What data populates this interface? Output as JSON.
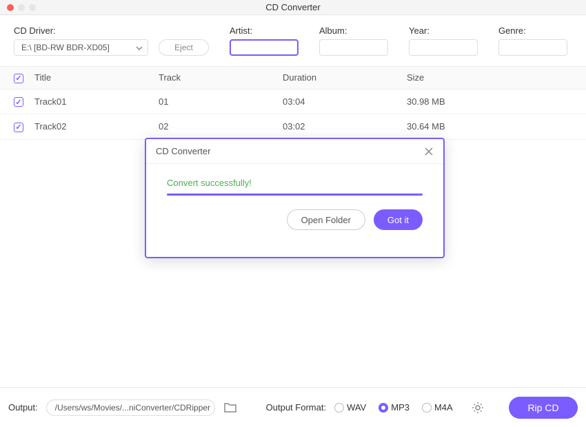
{
  "window": {
    "title": "CD Converter"
  },
  "form": {
    "cd_driver_label": "CD Driver:",
    "cd_driver_value": "E:\\ [BD-RW   BDR-XD05]",
    "eject_label": "Eject",
    "artist_label": "Artist:",
    "artist_value": "",
    "album_label": "Album:",
    "album_value": "",
    "year_label": "Year:",
    "year_value": "",
    "genre_label": "Genre:",
    "genre_value": ""
  },
  "table": {
    "headers": {
      "title": "Title",
      "track": "Track",
      "duration": "Duration",
      "size": "Size"
    },
    "rows": [
      {
        "title": "Track01",
        "track": "01",
        "duration": "03:04",
        "size": "30.98 MB"
      },
      {
        "title": "Track02",
        "track": "02",
        "duration": "03:02",
        "size": "30.64 MB"
      }
    ]
  },
  "modal": {
    "title": "CD Converter",
    "message": "Convert successfully!",
    "open_folder": "Open Folder",
    "got_it": "Got it"
  },
  "bottom": {
    "output_label": "Output:",
    "output_path": "/Users/ws/Movies/...niConverter/CDRipper",
    "format_label": "Output Format:",
    "formats": {
      "wav": "WAV",
      "mp3": "MP3",
      "m4a": "M4A"
    },
    "rip_label": "Rip CD"
  }
}
